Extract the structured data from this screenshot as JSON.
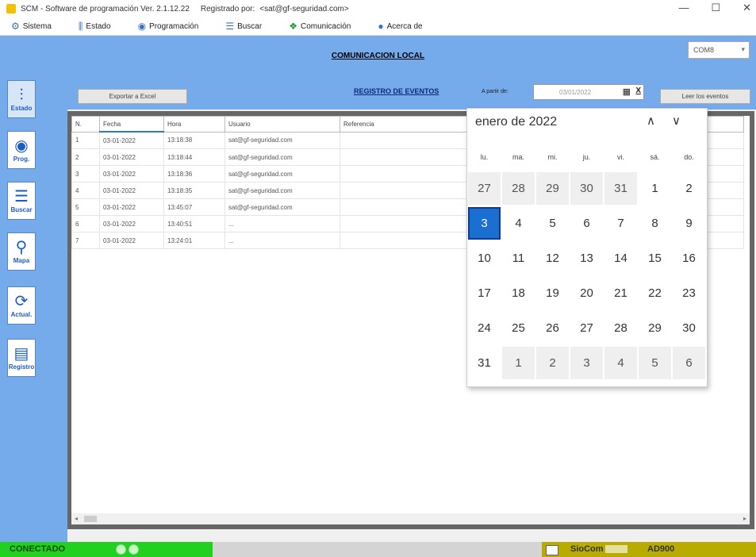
{
  "window": {
    "app_name": "SCM - Software de programación Ver. 2.1.12.22",
    "registered_label": "Registrado por:",
    "registered_user": "<sat@gf-seguridad.com>",
    "controls": {
      "minimize": "—",
      "maximize": "☐",
      "close": "✕"
    }
  },
  "menu": [
    {
      "label": "Sistema",
      "icon": "gear-icon",
      "glyph": "⚙"
    },
    {
      "label": "Estado",
      "icon": "bars-icon",
      "glyph": "⫼"
    },
    {
      "label": "Programación",
      "icon": "globe-icon",
      "glyph": "◉"
    },
    {
      "label": "Buscar",
      "icon": "list-icon",
      "glyph": "☰"
    },
    {
      "label": "Comunicación",
      "icon": "comm-icon",
      "glyph": "❖"
    },
    {
      "label": "Acerca de",
      "icon": "info-icon",
      "glyph": "●"
    }
  ],
  "header": {
    "title": "COMUNICACION LOCAL",
    "port": "COM8"
  },
  "sidebar": [
    {
      "label": "Estado",
      "glyph": "⫶",
      "icon": "sliders-icon"
    },
    {
      "label": "Prog.",
      "glyph": "◉",
      "icon": "program-icon"
    },
    {
      "label": "Buscar",
      "glyph": "☰",
      "icon": "list-icon"
    },
    {
      "label": "Mapa",
      "glyph": "⚲",
      "icon": "map-pin-icon"
    },
    {
      "label": "Actual.",
      "glyph": "⟳",
      "icon": "refresh-icon"
    },
    {
      "label": "Registro",
      "glyph": "▤",
      "icon": "database-icon"
    }
  ],
  "events": {
    "export_label": "Exportar a Excel",
    "title": "REGISTRO DE EVENTOS",
    "from_label": "A partir de:",
    "date_value": "03/01/2022",
    "calendar_glyph": "▦",
    "clear_glyph": "X",
    "read_button": "Leer los eventos",
    "columns": [
      "N.",
      "Fecha",
      "Hora",
      "Usuario",
      "Referencia"
    ],
    "rows": [
      [
        "1",
        "03-01-2022",
        "13:18:38",
        "sat@gf-seguridad.com",
        ""
      ],
      [
        "2",
        "03-01-2022",
        "13:18:44",
        "sat@gf-seguridad.com",
        ""
      ],
      [
        "3",
        "03-01-2022",
        "13:18:36",
        "sat@gf-seguridad.com",
        ""
      ],
      [
        "4",
        "03-01-2022",
        "13:18:35",
        "sat@gf-seguridad.com",
        ""
      ],
      [
        "5",
        "03-01-2022",
        "13:45:07",
        "sat@gf-seguridad.com",
        ""
      ],
      [
        "6",
        "03-01-2022",
        "13:40:51",
        "...",
        ""
      ],
      [
        "7",
        "03-01-2022",
        "13:24:01",
        "...",
        ""
      ]
    ]
  },
  "calendar": {
    "month_title": "enero de 2022",
    "nav_up": "∧",
    "nav_down": "∨",
    "weekdays": [
      "lu.",
      "ma.",
      "mi.",
      "ju.",
      "vi.",
      "sá.",
      "do."
    ],
    "selected_day": "3",
    "weeks": [
      [
        {
          "d": "27",
          "o": true
        },
        {
          "d": "28",
          "o": true
        },
        {
          "d": "29",
          "o": true
        },
        {
          "d": "30",
          "o": true
        },
        {
          "d": "31",
          "o": true
        },
        {
          "d": "1",
          "o": false
        },
        {
          "d": "2",
          "o": false
        }
      ],
      [
        {
          "d": "3",
          "o": false,
          "s": true
        },
        {
          "d": "4",
          "o": false
        },
        {
          "d": "5",
          "o": false
        },
        {
          "d": "6",
          "o": false
        },
        {
          "d": "7",
          "o": false
        },
        {
          "d": "8",
          "o": false
        },
        {
          "d": "9",
          "o": false
        }
      ],
      [
        {
          "d": "10",
          "o": false
        },
        {
          "d": "11",
          "o": false
        },
        {
          "d": "12",
          "o": false
        },
        {
          "d": "13",
          "o": false
        },
        {
          "d": "14",
          "o": false
        },
        {
          "d": "15",
          "o": false
        },
        {
          "d": "16",
          "o": false
        }
      ],
      [
        {
          "d": "17",
          "o": false
        },
        {
          "d": "18",
          "o": false
        },
        {
          "d": "19",
          "o": false
        },
        {
          "d": "20",
          "o": false
        },
        {
          "d": "21",
          "o": false
        },
        {
          "d": "22",
          "o": false
        },
        {
          "d": "23",
          "o": false
        }
      ],
      [
        {
          "d": "24",
          "o": false
        },
        {
          "d": "25",
          "o": false
        },
        {
          "d": "26",
          "o": false
        },
        {
          "d": "27",
          "o": false
        },
        {
          "d": "28",
          "o": false
        },
        {
          "d": "29",
          "o": false
        },
        {
          "d": "30",
          "o": false
        }
      ],
      [
        {
          "d": "31",
          "o": false
        },
        {
          "d": "1",
          "o": true
        },
        {
          "d": "2",
          "o": true
        },
        {
          "d": "3",
          "o": true
        },
        {
          "d": "4",
          "o": true
        },
        {
          "d": "5",
          "o": true
        },
        {
          "d": "6",
          "o": true
        }
      ]
    ]
  },
  "status": {
    "connection": "CONECTADO",
    "device_brand": "SioCom",
    "device_model": "AD900",
    "colors": {
      "connected": "#22d120",
      "device": "#b9ac00",
      "accent": "#75aaeb"
    }
  }
}
